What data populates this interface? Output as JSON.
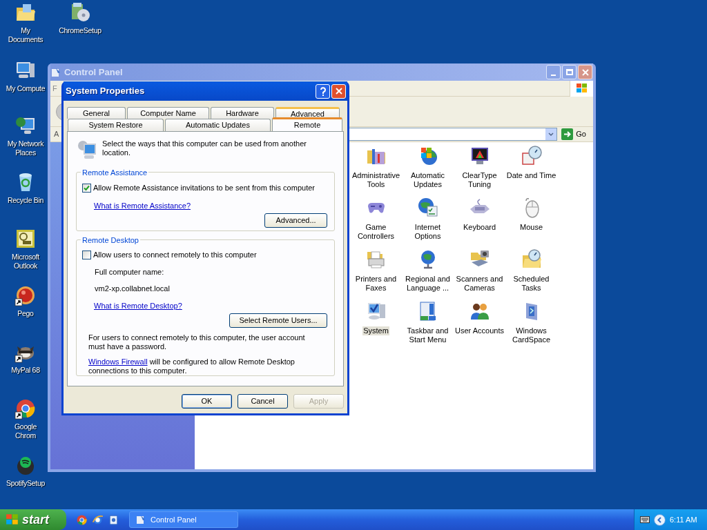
{
  "desktop_icons": [
    {
      "label": "My Documents",
      "kind": "folder",
      "shortcut": false
    },
    {
      "label": "ChromeSetup",
      "kind": "installer",
      "shortcut": false
    },
    {
      "label": "My Compute",
      "kind": "computer",
      "shortcut": false
    },
    {
      "label": "My Network Places",
      "kind": "network",
      "shortcut": false
    },
    {
      "label": "Recycle Bin",
      "kind": "recycle",
      "shortcut": false
    },
    {
      "label": "Microsoft Outlook",
      "kind": "outlook",
      "shortcut": false
    },
    {
      "label": "Pego",
      "kind": "ball",
      "shortcut": true
    },
    {
      "label": "MyPal 68",
      "kind": "animal",
      "shortcut": true
    },
    {
      "label": "Google Chrom",
      "kind": "roundlogo",
      "shortcut": true
    },
    {
      "label": "SpotifySetup",
      "kind": "spotify",
      "shortcut": false
    }
  ],
  "control_panel": {
    "title": "Control Panel",
    "active": false,
    "menu_fragment": "F",
    "address_fragment": "A",
    "go_button": "Go",
    "items": [
      {
        "label": "Administrative Tools",
        "kind": "admin",
        "selected": false
      },
      {
        "label": "Automatic Updates",
        "kind": "updates",
        "selected": false
      },
      {
        "label": "ClearType Tuning",
        "kind": "cleartype",
        "selected": false
      },
      {
        "label": "Date and Time",
        "kind": "datetime",
        "selected": false
      },
      {
        "label": "Game Controllers",
        "kind": "gamepad",
        "selected": false
      },
      {
        "label": "Internet Options",
        "kind": "internet",
        "selected": false
      },
      {
        "label": "Keyboard",
        "kind": "keyboard",
        "selected": false
      },
      {
        "label": "Mouse",
        "kind": "mouse",
        "selected": false
      },
      {
        "label": "Printers and Faxes",
        "kind": "printer",
        "selected": false
      },
      {
        "label": "Regional and Language ...",
        "kind": "regional",
        "selected": false
      },
      {
        "label": "Scanners and Cameras",
        "kind": "scanner",
        "selected": false
      },
      {
        "label": "Scheduled Tasks",
        "kind": "scheduled",
        "selected": false
      },
      {
        "label": "System",
        "kind": "system",
        "selected": true
      },
      {
        "label": "Taskbar and Start Menu",
        "kind": "taskbar",
        "selected": false
      },
      {
        "label": "User Accounts",
        "kind": "users",
        "selected": false
      },
      {
        "label": "Windows CardSpace",
        "kind": "cardspace",
        "selected": false
      }
    ]
  },
  "dialog": {
    "title": "System Properties",
    "tab_rows": [
      {
        "tabs": [
          {
            "label": "General",
            "selected": false,
            "hot": false
          },
          {
            "label": "Computer Name",
            "selected": false,
            "hot": false
          },
          {
            "label": "Hardware",
            "selected": false,
            "hot": false
          },
          {
            "label": "Advanced",
            "selected": false,
            "hot": true
          }
        ]
      },
      {
        "tabs": [
          {
            "label": "System Restore",
            "selected": false,
            "hot": false
          },
          {
            "label": "Automatic Updates",
            "selected": false,
            "hot": false
          },
          {
            "label": "Remote",
            "selected": true,
            "hot": false
          }
        ]
      }
    ],
    "intro": "Select the ways that this computer can be used from another location.",
    "remote_assistance": {
      "legend": "Remote Assistance",
      "checkbox": {
        "label": "Allow Remote Assistance invitations to be sent from this computer",
        "checked": true
      },
      "link": "What is Remote Assistance?",
      "button": "Advanced..."
    },
    "remote_desktop": {
      "legend": "Remote Desktop",
      "checkbox": {
        "label": "Allow users to connect remotely to this computer",
        "checked": false
      },
      "full_name_label": "Full computer name:",
      "full_name": "vm2-xp.collabnet.local",
      "link": "What is Remote Desktop?",
      "button": "Select Remote Users...",
      "note": "For users to connect remotely to this computer, the user account must have a password.",
      "firewall_link": "Windows Firewall",
      "firewall_text": "will be configured to allow Remote Desktop connections to this computer."
    },
    "buttons": [
      {
        "label": "OK",
        "default": true,
        "disabled": false
      },
      {
        "label": "Cancel",
        "default": false,
        "disabled": false
      },
      {
        "label": "Apply",
        "default": false,
        "disabled": true
      }
    ]
  },
  "taskbar": {
    "start": "start",
    "tasks": [
      {
        "label": "Control Panel",
        "selected": false
      }
    ],
    "clock": "6:11 AM"
  }
}
